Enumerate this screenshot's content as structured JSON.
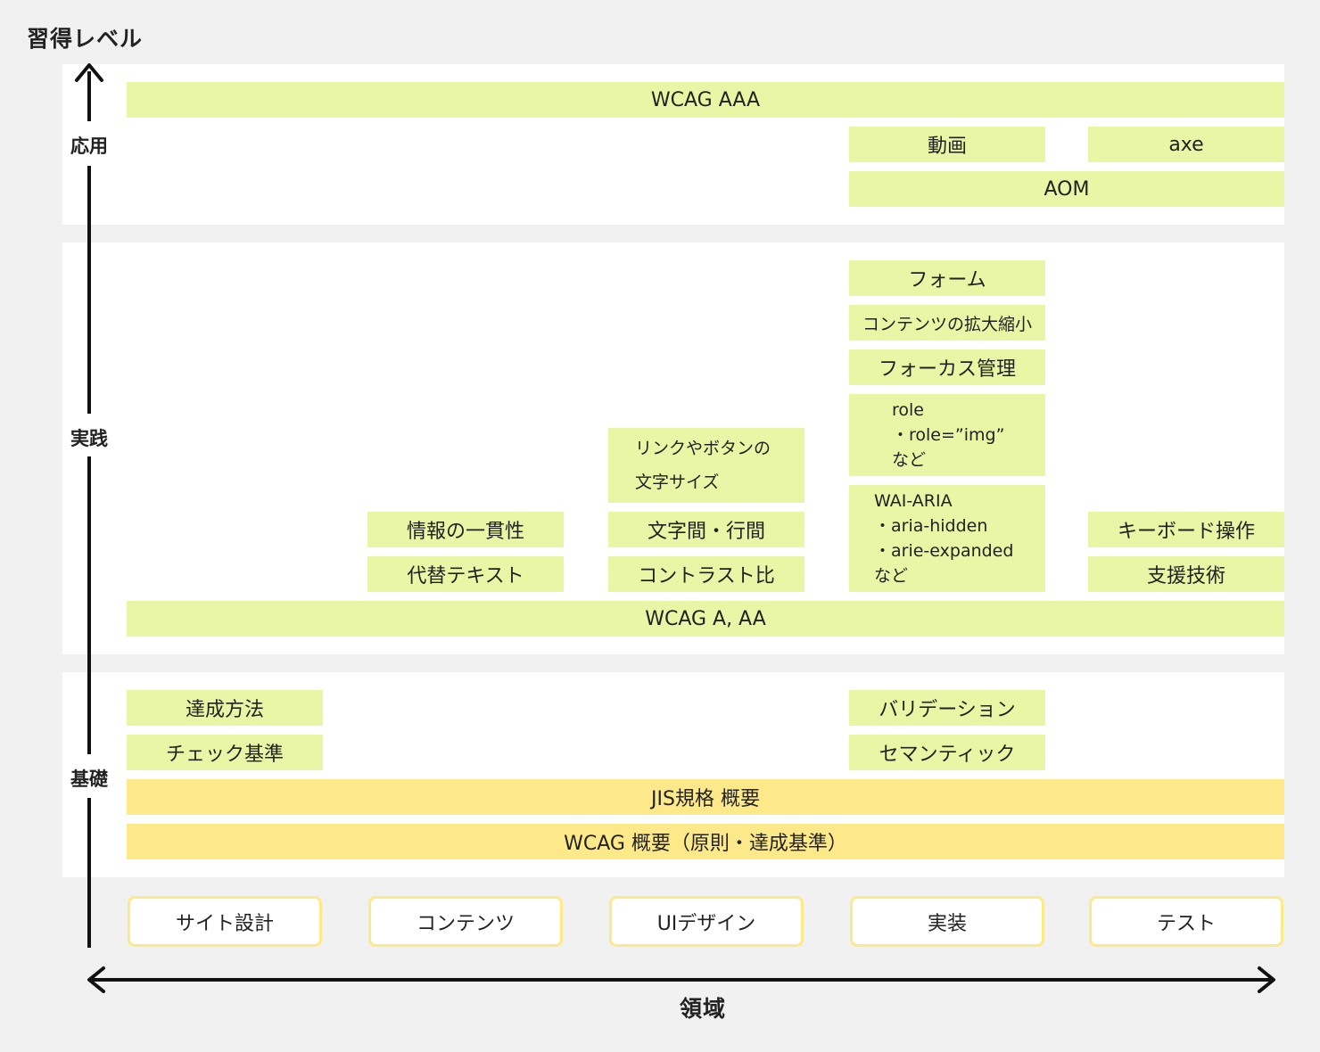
{
  "y_axis_title": "習得レベル",
  "x_axis_title": "領域",
  "levels": {
    "advanced": "応用",
    "practice": "実践",
    "basic": "基礎"
  },
  "domains": [
    "サイト設計",
    "コンテンツ",
    "UIデザイン",
    "実装",
    "テスト"
  ],
  "advanced": {
    "wcag_aaa": "WCAG AAA",
    "video": "動画",
    "axe": "axe",
    "aom": "AOM"
  },
  "practice": {
    "info_consistency": "情報の一貫性",
    "alt_text": "代替テキスト",
    "link_button_size_line1": "リンクやボタンの",
    "link_button_size_line2": "文字サイズ",
    "spacing": "文字間・行間",
    "contrast": "コントラスト比",
    "form": "フォーム",
    "zoom": "コンテンツの拡大縮小",
    "focus": "フォーカス管理",
    "role_line1": "role",
    "role_line2": "・role=”img”",
    "role_line3": "など",
    "aria_line1": "WAI-ARIA",
    "aria_line2": "・aria-hidden",
    "aria_line3": "・arie-expanded",
    "aria_line4": "など",
    "keyboard": "キーボード操作",
    "assistive": "支援技術",
    "wcag_a_aa": "WCAG A, AA"
  },
  "basic": {
    "techniques": "達成方法",
    "check_criteria": "チェック基準",
    "validation": "バリデーション",
    "semantics": "セマンティック",
    "jis": "JIS規格 概要",
    "wcag_overview": "WCAG 概要（原則・達成基準）"
  },
  "colors": {
    "green_box": "#e9f6a6",
    "yellow_box": "#fde98a",
    "band": "#ffffff",
    "background": "#f1f1f1"
  }
}
